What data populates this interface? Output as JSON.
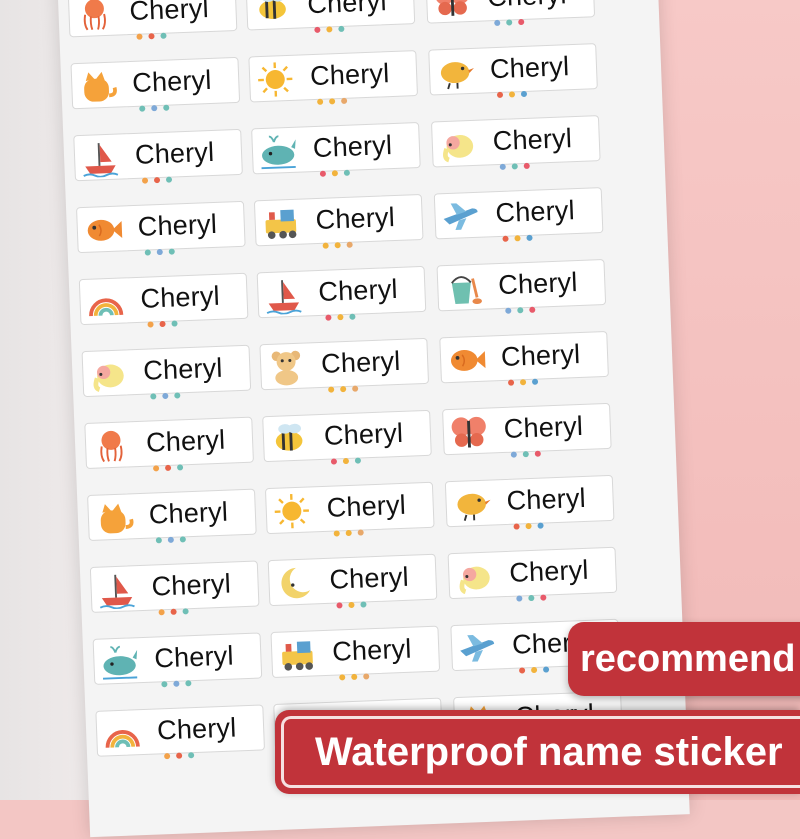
{
  "labels": [
    {
      "name": "Cheryl",
      "icon": "jellyfish-icon"
    },
    {
      "name": "Cheryl",
      "icon": "bee-icon"
    },
    {
      "name": "Cheryl",
      "icon": "butterfly-icon"
    },
    {
      "name": "Cheryl",
      "icon": "cat-icon"
    },
    {
      "name": "Cheryl",
      "icon": "sun-icon"
    },
    {
      "name": "Cheryl",
      "icon": "bird-icon"
    },
    {
      "name": "Cheryl",
      "icon": "sailboat-icon"
    },
    {
      "name": "Cheryl",
      "icon": "whale-icon"
    },
    {
      "name": "Cheryl",
      "icon": "elephant-icon"
    },
    {
      "name": "Cheryl",
      "icon": "fish-icon"
    },
    {
      "name": "Cheryl",
      "icon": "train-icon"
    },
    {
      "name": "Cheryl",
      "icon": "airplane-icon"
    },
    {
      "name": "Cheryl",
      "icon": "rainbow-icon"
    },
    {
      "name": "Cheryl",
      "icon": "sailboat-icon"
    },
    {
      "name": "Cheryl",
      "icon": "sand-bucket-icon"
    },
    {
      "name": "Cheryl",
      "icon": "elephant-icon"
    },
    {
      "name": "Cheryl",
      "icon": "teddy-bear-icon"
    },
    {
      "name": "Cheryl",
      "icon": "fish-icon"
    },
    {
      "name": "Cheryl",
      "icon": "jellyfish-icon"
    },
    {
      "name": "Cheryl",
      "icon": "bee-icon"
    },
    {
      "name": "Cheryl",
      "icon": "butterfly-icon"
    },
    {
      "name": "Cheryl",
      "icon": "cat-icon"
    },
    {
      "name": "Cheryl",
      "icon": "sun-icon"
    },
    {
      "name": "Cheryl",
      "icon": "bird-icon"
    },
    {
      "name": "Cheryl",
      "icon": "sailboat-icon"
    },
    {
      "name": "Cheryl",
      "icon": "moon-icon"
    },
    {
      "name": "Cheryl",
      "icon": "elephant-icon"
    },
    {
      "name": "Cheryl",
      "icon": "whale-icon"
    },
    {
      "name": "Cheryl",
      "icon": "train-icon"
    },
    {
      "name": "Cheryl",
      "icon": "airplane-icon"
    },
    {
      "name": "Cheryl",
      "icon": "rainbow-icon"
    },
    {
      "name": "Cheryl",
      "icon": "teddy-bear-icon"
    },
    {
      "name": "Cheryl",
      "icon": "cat-icon"
    }
  ],
  "banners": {
    "recommend": "recommend",
    "waterproof": "Waterproof name sticker"
  },
  "colors": {
    "banner_red": "#c1333a",
    "background_pink": "#f3c6c4",
    "sheet_white": "#f4f4f4"
  }
}
